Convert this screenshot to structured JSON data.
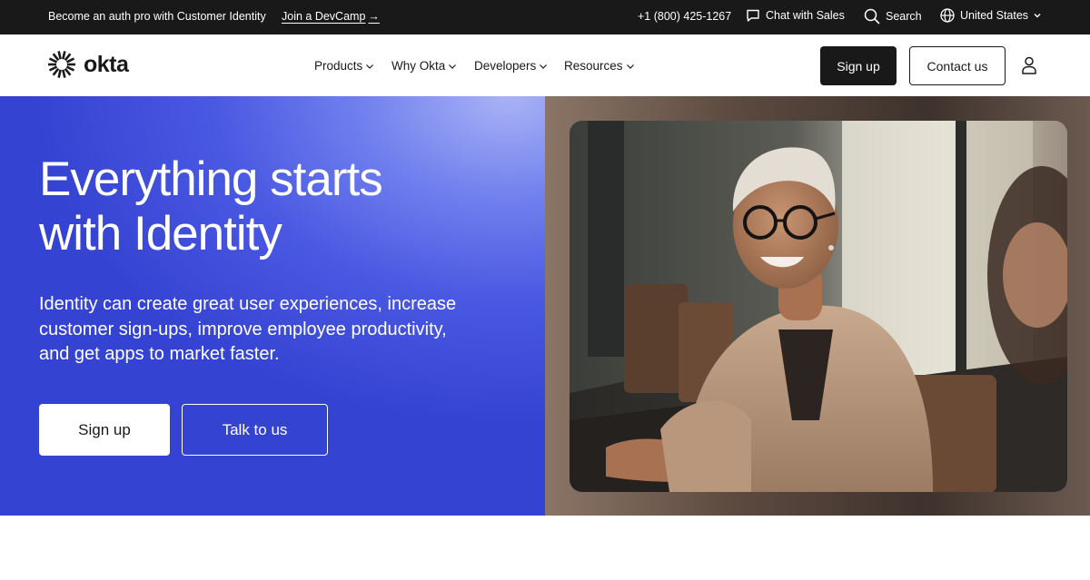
{
  "topbar": {
    "promo_text": "Become an auth pro with Customer Identity",
    "promo_link": "Join a DevCamp",
    "phone": "+1 (800) 425-1267",
    "chat_label": "Chat with Sales",
    "search_label": "Search",
    "region_label": "United States"
  },
  "nav": {
    "logo_text": "okta",
    "menu": [
      {
        "label": "Products"
      },
      {
        "label": "Why Okta"
      },
      {
        "label": "Developers"
      },
      {
        "label": "Resources"
      }
    ],
    "signup_label": "Sign up",
    "contact_label": "Contact us"
  },
  "hero": {
    "headline_line1": "Everything starts",
    "headline_line2": "with Identity",
    "subtext": "Identity can create great user experiences, increase customer sign-ups, improve employee productivity, and get apps to market faster.",
    "signup_label": "Sign up",
    "talk_label": "Talk to us"
  },
  "icons": {
    "chat": "chat-bubble-icon",
    "search": "search-icon",
    "region": "globe-icon",
    "region_dropdown": "chevron-down-icon",
    "account": "user-icon",
    "logo": "okta-sunburst-logo"
  },
  "colors": {
    "topbar_bg": "#191919",
    "hero_blue": "#4a59e2",
    "button_dark": "#191919"
  }
}
